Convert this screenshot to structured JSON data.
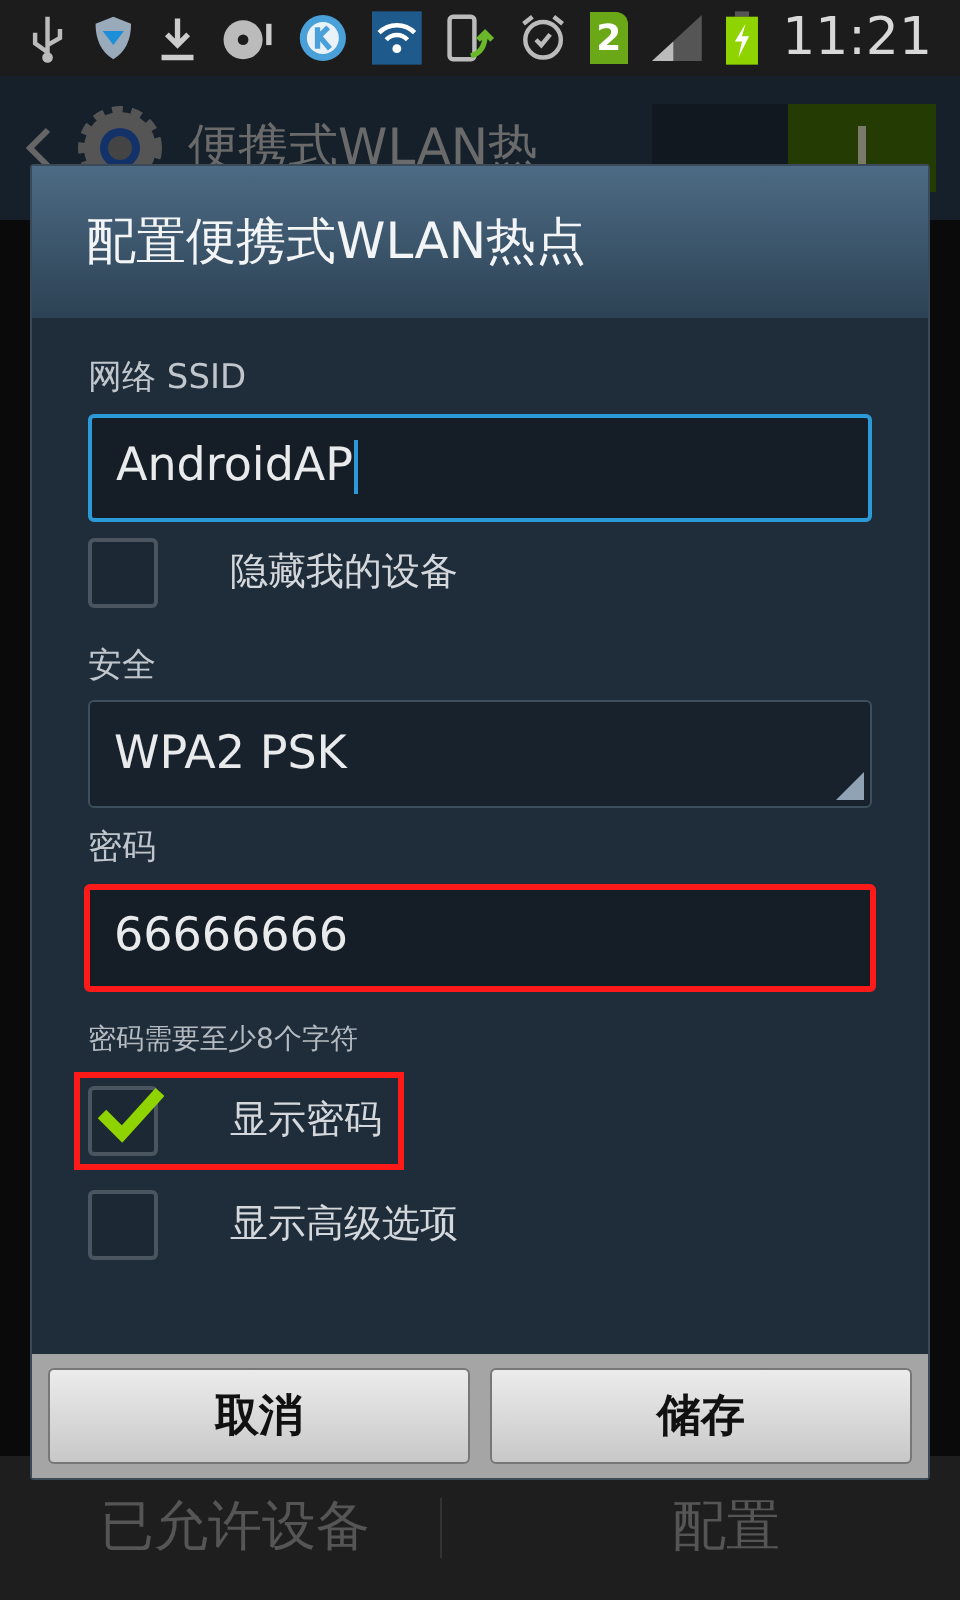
{
  "status_bar": {
    "sim_badge": "2",
    "time": "11:21",
    "battery_charging": true
  },
  "background": {
    "title": "便携式WLAN热",
    "switch_on": true,
    "bottom_tabs": [
      "已允许设备",
      "配置"
    ]
  },
  "dialog": {
    "title": "配置便携式WLAN热点",
    "fields": [
      {
        "kind": "input",
        "label": "网络 SSID",
        "value": "AndroidAP",
        "focused": true,
        "annotated": false
      },
      {
        "kind": "checkbox",
        "label": "隐藏我的设备",
        "checked": false,
        "annotated": false
      },
      {
        "kind": "select",
        "label": "安全",
        "value": "WPA2 PSK"
      },
      {
        "kind": "input",
        "label": "密码",
        "value": "66666666",
        "focused": false,
        "annotated": true,
        "hint": "密码需要至少8个字符"
      },
      {
        "kind": "checkbox",
        "label": "显示密码",
        "checked": true,
        "annotated": true
      },
      {
        "kind": "checkbox",
        "label": "显示高级选项",
        "checked": false,
        "annotated": false
      }
    ],
    "buttons": [
      "取消",
      "储存"
    ]
  }
}
